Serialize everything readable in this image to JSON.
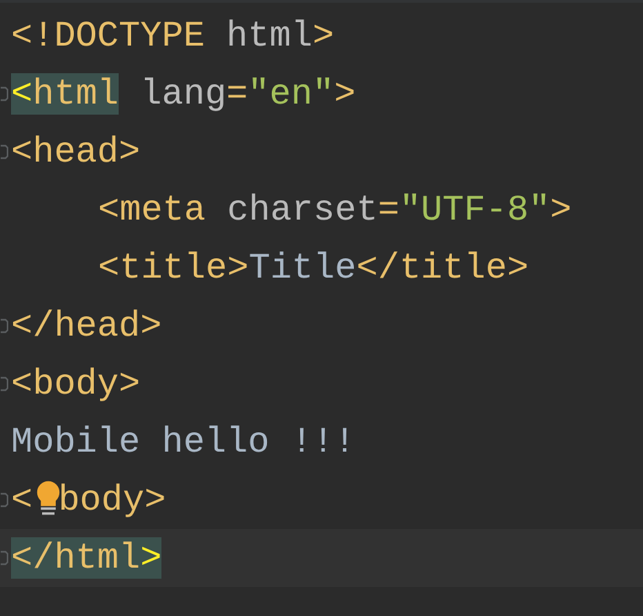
{
  "editor": {
    "lines": [
      {
        "fold": false,
        "current": false,
        "tokens": [
          {
            "text": "<!DOCTYPE",
            "kind": "tag",
            "matched": false
          },
          {
            "text": " html",
            "kind": "attr",
            "matched": false
          },
          {
            "text": ">",
            "kind": "tag",
            "matched": false
          }
        ]
      },
      {
        "fold": true,
        "current": false,
        "tokens": [
          {
            "text": "<",
            "kind": "brace",
            "matched": true
          },
          {
            "text": "html",
            "kind": "tag",
            "matched": true
          },
          {
            "text": " lang",
            "kind": "attr",
            "matched": false
          },
          {
            "text": "=",
            "kind": "tag",
            "matched": false
          },
          {
            "text": "\"en\"",
            "kind": "string",
            "matched": false
          },
          {
            "text": ">",
            "kind": "tag",
            "matched": false
          }
        ]
      },
      {
        "fold": true,
        "current": false,
        "tokens": [
          {
            "text": "<head>",
            "kind": "tag",
            "matched": false
          }
        ],
        "children": [
          {
            "fold": false,
            "current": false,
            "tokens": [
              {
                "text": "<meta",
                "kind": "tag",
                "matched": false
              },
              {
                "text": " charset",
                "kind": "attr",
                "matched": false
              },
              {
                "text": "=",
                "kind": "tag",
                "matched": false
              },
              {
                "text": "\"UTF-8\"",
                "kind": "string",
                "matched": false
              },
              {
                "text": ">",
                "kind": "tag",
                "matched": false
              }
            ]
          },
          {
            "fold": false,
            "current": false,
            "tokens": [
              {
                "text": "<title>",
                "kind": "tag",
                "matched": false
              },
              {
                "text": "Title",
                "kind": "text",
                "matched": false
              },
              {
                "text": "</title>",
                "kind": "tag",
                "matched": false
              }
            ]
          }
        ]
      },
      {
        "fold": true,
        "current": false,
        "tokens": [
          {
            "text": "</head>",
            "kind": "tag",
            "matched": false
          }
        ]
      },
      {
        "fold": true,
        "current": false,
        "tokens": [
          {
            "text": "<body>",
            "kind": "tag",
            "matched": false
          }
        ]
      },
      {
        "fold": false,
        "current": false,
        "tokens": [
          {
            "text": "Mobile hello !!!",
            "kind": "text",
            "matched": false
          }
        ]
      },
      {
        "fold": true,
        "current": false,
        "bulb": true,
        "tokens": [
          {
            "text": "<",
            "kind": "tag",
            "matched": false
          },
          {
            "text": "body>",
            "kind": "tag",
            "matched": false
          }
        ]
      },
      {
        "fold": true,
        "current": true,
        "tokens": [
          {
            "text": "</html",
            "kind": "tag",
            "matched": true
          },
          {
            "text": ">",
            "kind": "brace",
            "matched": true
          }
        ]
      }
    ]
  }
}
